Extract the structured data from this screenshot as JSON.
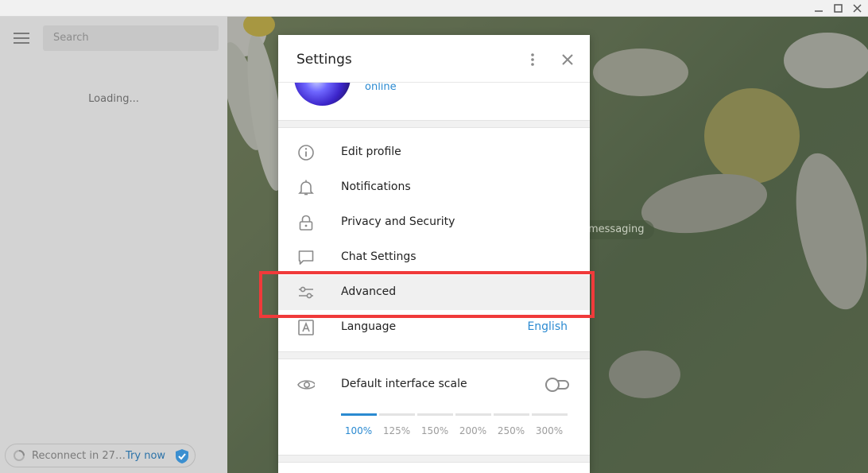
{
  "window": {
    "controls": {
      "minimize_icon": "minimize-icon",
      "maximize_icon": "maximize-icon",
      "close_icon": "close-icon"
    }
  },
  "sidebar": {
    "search_placeholder": "Search",
    "loading_text": "Loading...",
    "reconnect": {
      "text": "Reconnect in 27 s...",
      "link": "Try now"
    }
  },
  "chat": {
    "service_message": "messaging"
  },
  "settings": {
    "title": "Settings",
    "profile": {
      "status": "online"
    },
    "items": [
      {
        "label": "Edit profile",
        "icon": "info-icon"
      },
      {
        "label": "Notifications",
        "icon": "bell-icon"
      },
      {
        "label": "Privacy and Security",
        "icon": "lock-icon"
      },
      {
        "label": "Chat Settings",
        "icon": "chat-bubble-icon"
      },
      {
        "label": "Advanced",
        "icon": "sliders-icon"
      },
      {
        "label": "Language",
        "icon": "language-icon",
        "value": "English"
      }
    ],
    "scale": {
      "label": "Default interface scale",
      "enabled": false,
      "options": [
        "100%",
        "125%",
        "150%",
        "200%",
        "250%",
        "300%"
      ],
      "selected": "100%"
    }
  },
  "colors": {
    "accent": "#2b8ad1",
    "highlight_border": "#f03a3a"
  }
}
